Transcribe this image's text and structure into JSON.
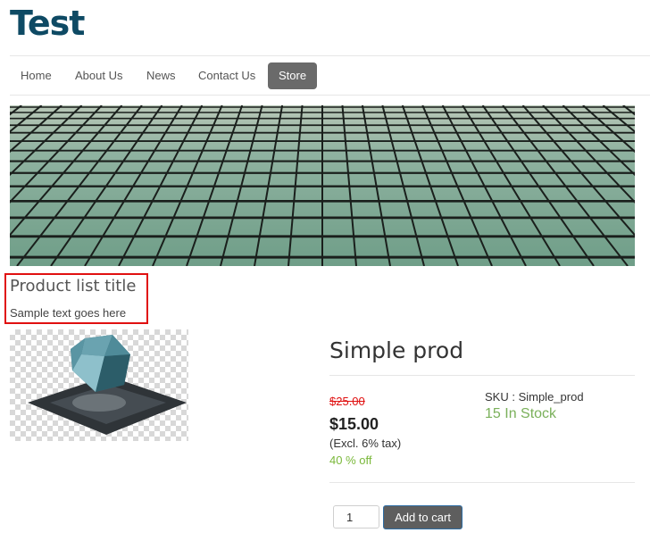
{
  "site": {
    "title": "Test"
  },
  "nav": {
    "items": [
      {
        "label": "Home"
      },
      {
        "label": "About Us"
      },
      {
        "label": "News"
      },
      {
        "label": "Contact Us"
      },
      {
        "label": "Store",
        "active": true
      }
    ]
  },
  "intro": {
    "title": "Product list title",
    "text": "Sample text goes here"
  },
  "product": {
    "name": "Simple prod",
    "old_price": "$25.00",
    "price": "$15.00",
    "tax_note": "(Excl. 6% tax)",
    "discount": "40 % off",
    "sku": "SKU : Simple_prod",
    "stock": "15 In Stock",
    "quantity": "1",
    "add_to_cart_label": "Add to cart"
  },
  "colors": {
    "title": "#0e4a64",
    "active_nav": "#6a6a6a",
    "sale_red": "#e01010",
    "discount_green": "#7ab83a",
    "stock_green": "#7ab05a"
  }
}
